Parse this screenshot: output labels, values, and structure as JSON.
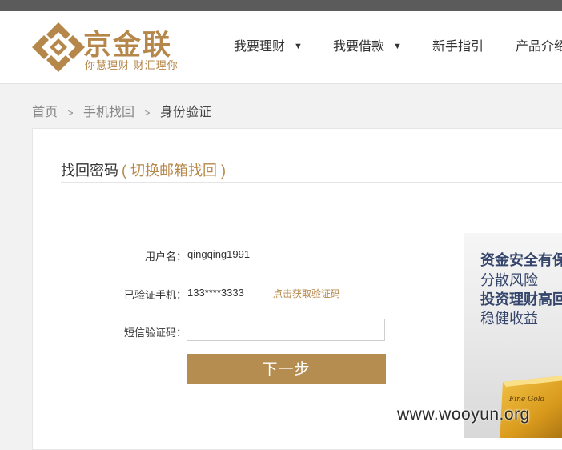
{
  "brand": {
    "name": "京金联",
    "slogan": "你慧理财   财汇理你",
    "color": "#b6874a"
  },
  "nav": {
    "items": [
      {
        "label": "我要理财",
        "has_dropdown": true
      },
      {
        "label": "我要借款",
        "has_dropdown": true
      },
      {
        "label": "新手指引",
        "has_dropdown": false
      },
      {
        "label": "产品介绍",
        "has_dropdown": false
      }
    ],
    "caret": "▼"
  },
  "breadcrumb": {
    "home": "首页",
    "middle": "手机找回",
    "current": "身份验证",
    "separator": ">"
  },
  "form": {
    "title": "找回密码",
    "switch_link": "( 切换邮箱找回 )",
    "username_label": "用户名：",
    "username_value": "qingqing1991",
    "phone_label": "已验证手机：",
    "phone_value": "133****3333",
    "get_code_link": "点击获取验证码",
    "sms_label": "短信验证码：",
    "sms_value": "",
    "next_button": "下一步",
    "button_color": "#b68d50"
  },
  "promo": {
    "line1": "资金安全有保",
    "line2": "分散风险",
    "line3": "投资理财高回",
    "line4": "稳健收益",
    "gold_text": "Fine Gold"
  },
  "watermark": "www.wooyun.org"
}
